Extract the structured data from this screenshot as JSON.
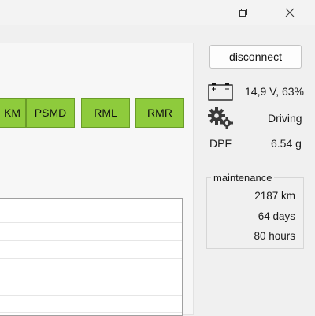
{
  "window": {
    "minimize_icon": "minimize-icon",
    "maximize_icon": "restore-icon",
    "close_icon": "close-icon"
  },
  "modes": [
    {
      "label": "KM"
    },
    {
      "label": "PSMD"
    },
    {
      "label": "RML"
    },
    {
      "label": "RMR"
    }
  ],
  "connection": {
    "disconnect_label": "disconnect"
  },
  "status": {
    "battery_icon": "battery-icon",
    "battery_value": "14,9 V, 63%",
    "gears_icon": "gears-icon",
    "state": "Driving",
    "dpf_label": "DPF",
    "dpf_value": "6.54 g"
  },
  "maintenance": {
    "title": "maintenance",
    "distance": "2187 km",
    "days": "64 days",
    "hours": "80 hours"
  },
  "colors": {
    "mode_button": "#8ecb3c",
    "mode_button_border": "#6a9c28",
    "background": "#f0f0f0"
  }
}
